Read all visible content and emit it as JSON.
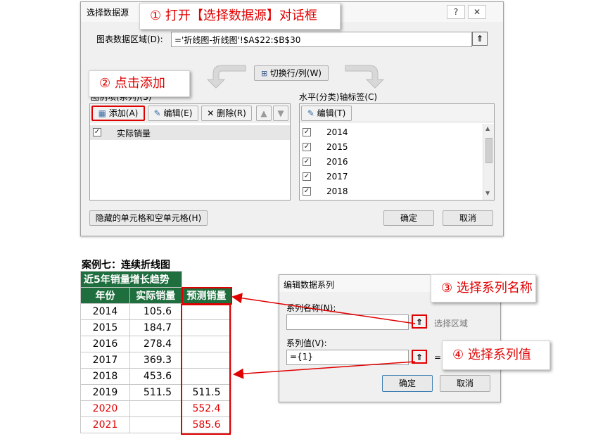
{
  "dialog_select_source": {
    "title": "选择数据源",
    "help": "?",
    "close": "✕",
    "range_label": "图表数据区域(D):",
    "range_value": "='折线图-折线图'!$A$22:$B$30",
    "switch_button": "切换行/列(W)",
    "legend_label": "图例项(系列)(S)",
    "add_button": "添加(A)",
    "edit_button": "编辑(E)",
    "delete_button": "删除(R)",
    "series": [
      {
        "label": "实际销量",
        "checked": true
      }
    ],
    "axis_label": "水平(分类)轴标签(C)",
    "axis_edit_button": "编辑(T)",
    "axis_items": [
      "2014",
      "2015",
      "2016",
      "2017",
      "2018"
    ],
    "hidden_cells_button": "隐藏的单元格和空单元格(H)",
    "ok_button": "确定",
    "cancel_button": "取消"
  },
  "callouts": {
    "c1": "① 打开【选择数据源】对话框",
    "c2": "② 点击添加",
    "c3": "③ 选择系列名称",
    "c4": "④ 选择系列值"
  },
  "sheet": {
    "case_title": "案例七：连续折线图",
    "header_title": "近5年销量增长趋势",
    "columns": [
      "年份",
      "实际销量",
      "预测销量"
    ],
    "rows": [
      {
        "year": "2014",
        "actual": "105.6",
        "forecast": "",
        "red": false
      },
      {
        "year": "2015",
        "actual": "184.7",
        "forecast": "",
        "red": false
      },
      {
        "year": "2016",
        "actual": "278.4",
        "forecast": "",
        "red": false
      },
      {
        "year": "2017",
        "actual": "369.3",
        "forecast": "",
        "red": false
      },
      {
        "year": "2018",
        "actual": "453.6",
        "forecast": "",
        "red": false
      },
      {
        "year": "2019",
        "actual": "511.5",
        "forecast": "511.5",
        "red": false
      },
      {
        "year": "2020",
        "actual": "",
        "forecast": "552.4",
        "red": true
      },
      {
        "year": "2021",
        "actual": "",
        "forecast": "585.6",
        "red": true
      }
    ]
  },
  "dialog_edit_series": {
    "title": "编辑数据系列",
    "name_label": "系列名称(N):",
    "name_value": "",
    "select_range_hint": "选择区域",
    "values_label": "系列值(V):",
    "values_value": "={1}",
    "values_preview": "=",
    "ok_button": "确定",
    "cancel_button": "取消"
  },
  "colors": {
    "accent_red": "#e00000",
    "header_green": "#1e6e3e"
  }
}
